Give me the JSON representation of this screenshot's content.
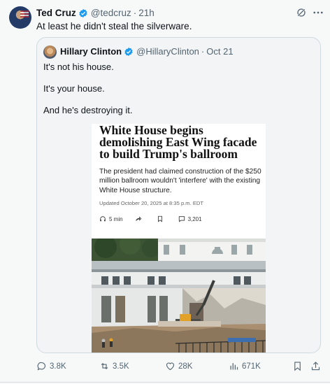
{
  "tweet": {
    "author_name": "Ted Cruz",
    "handle": "@tedcruz",
    "separator": "·",
    "time": "21h",
    "text": "At least he didn't steal the silverware."
  },
  "quoted": {
    "author_name": "Hillary Clinton",
    "handle": "@HillaryClinton",
    "separator": "·",
    "date": "Oct 21",
    "lines": [
      "It's not his house.",
      "It's your house.",
      "And he's destroying it."
    ],
    "article": {
      "headline": "White House begins demolishing East Wing facade to build Trump's ballroom",
      "dek": "The president had claimed construction of the $250 million ballroom wouldn't 'interfere' with the existing White House structure.",
      "updated": "Updated October 20, 2025 at 8:35 p.m. EDT",
      "listen": "5 min",
      "comments": "3,201"
    }
  },
  "actions": {
    "replies": "3.8K",
    "reposts": "3.5K",
    "likes": "28K",
    "views": "671K"
  },
  "colors": {
    "verified": "#1d9bf0",
    "muted": "#536471"
  },
  "icons": [
    "verified-badge-icon",
    "grok-icon",
    "more-icon",
    "headphones-icon",
    "share-icon",
    "bookmark-icon",
    "comment-icon",
    "reply-icon",
    "repost-icon",
    "like-icon",
    "views-icon",
    "share-icon"
  ]
}
